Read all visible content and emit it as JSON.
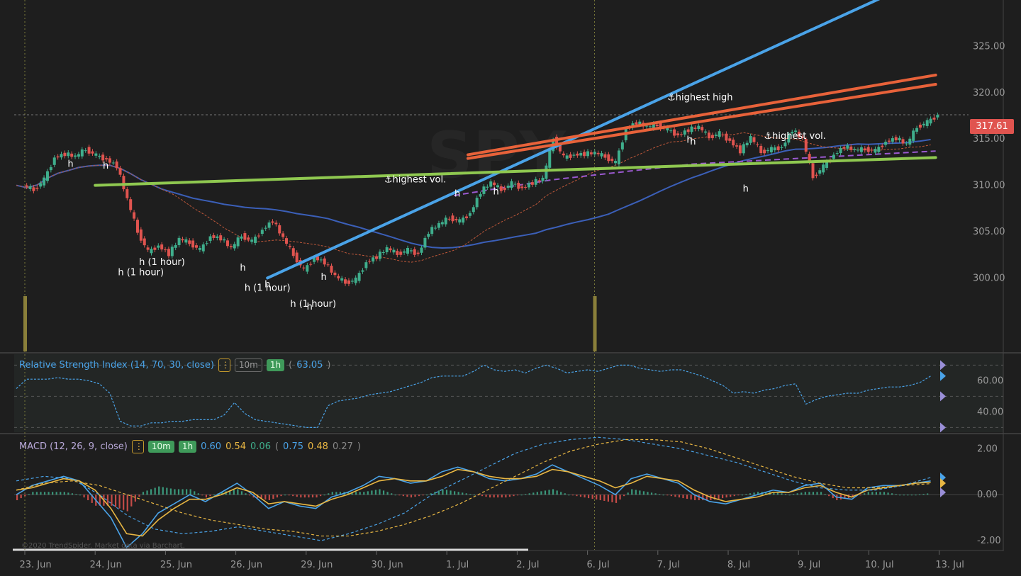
{
  "chart_data": [
    {
      "type": "candlestick",
      "watermark_ticker": "SPY",
      "last_price": "317.61",
      "y_ticks": [
        "325.00",
        "320.00",
        "315.00",
        "310.00",
        "305.00",
        "300.00"
      ],
      "ylim": [
        292,
        330
      ],
      "x_ticks": [
        "23. Jun",
        "24. Jun",
        "25. Jun",
        "26. Jun",
        "29. Jun",
        "30. Jun",
        "1. Jul",
        "2. Jul",
        "6. Jul",
        "7. Jul",
        "8. Jul",
        "9. Jul",
        "10. Jul",
        "13. Jul"
      ],
      "annotations": [
        {
          "text": "h",
          "x": 0.65,
          "y": 312.0
        },
        {
          "text": "h",
          "x": 1.15,
          "y": 311.8
        },
        {
          "text": "h (1 hour)",
          "x": 1.65,
          "y": 300.3
        },
        {
          "text": "h (1 hour)",
          "x": 1.95,
          "y": 301.4
        },
        {
          "text": "h",
          "x": 3.1,
          "y": 300.8
        },
        {
          "text": "h (1 hour)",
          "x": 3.45,
          "y": 298.6
        },
        {
          "text": "h",
          "x": 3.45,
          "y": 299.0
        },
        {
          "text": "h (1 hour)",
          "x": 4.1,
          "y": 296.9
        },
        {
          "text": "h",
          "x": 4.05,
          "y": 296.6
        },
        {
          "text": "h",
          "x": 4.25,
          "y": 299.8
        },
        {
          "text": "highest vol.",
          "x": 5.55,
          "y": 310.3
        },
        {
          "text": "h",
          "x": 6.15,
          "y": 308.8
        },
        {
          "text": "h",
          "x": 6.7,
          "y": 309.0
        },
        {
          "text": "highest high",
          "x": 9.6,
          "y": 319.2
        },
        {
          "text": "h",
          "x": 9.45,
          "y": 314.6
        },
        {
          "text": "h",
          "x": 9.5,
          "y": 314.4
        },
        {
          "text": "h",
          "x": 10.25,
          "y": 309.3
        },
        {
          "text": "highest vol.",
          "x": 10.95,
          "y": 315.0
        }
      ],
      "closes": [
        310.0,
        309.5,
        310.6,
        313.0,
        313.4,
        313.1,
        313.9,
        313.2,
        312.8,
        312.1,
        308.5,
        305.0,
        302.8,
        303.5,
        302.6,
        304.2,
        303.8,
        303.0,
        304.5,
        304.3,
        303.2,
        304.6,
        303.9,
        305.2,
        306.2,
        304.3,
        302.5,
        300.8,
        302.2,
        301.7,
        300.2,
        299.5,
        299.8,
        301.7,
        302.3,
        303.2,
        302.6,
        303.0,
        302.6,
        305.0,
        305.8,
        306.5,
        306.1,
        307.0,
        309.3,
        310.3,
        309.5,
        310.2,
        309.7,
        310.3,
        310.7,
        315.0,
        313.0,
        313.3,
        313.4,
        313.5,
        313.1,
        312.4,
        316.1,
        316.8,
        316.3,
        316.5,
        316.0,
        315.4,
        316.0,
        316.3,
        315.2,
        315.6,
        314.8,
        313.7,
        315.2,
        313.6,
        313.9,
        314.1,
        316.0,
        315.0,
        310.9,
        312.0,
        313.3,
        314.2,
        313.8,
        313.9,
        313.7,
        314.7,
        315.1,
        314.4,
        316.3,
        316.8,
        317.6
      ],
      "overlays": [
        {
          "name": "blue trendline",
          "color": "#4aa3e8",
          "points": [
            [
              3.45,
              300.0
            ],
            [
              12.4,
              331.0
            ]
          ]
        },
        {
          "name": "orange channel upper",
          "color": "#e8623a",
          "points": [
            [
              6.3,
              313.3
            ],
            [
              12.95,
              321.9
            ]
          ]
        },
        {
          "name": "orange channel lower",
          "color": "#e8623a",
          "points": [
            [
              6.3,
              312.9
            ],
            [
              12.95,
              320.9
            ]
          ]
        },
        {
          "name": "green support",
          "color": "#8fc850",
          "points": [
            [
              1.0,
              310.0
            ],
            [
              12.95,
              313.0
            ]
          ]
        }
      ],
      "bottom_time_range": [
        "23. Jun",
        "2. Jul"
      ],
      "copyright": "©2020 TrendSpider. Market data via Barchart."
    },
    {
      "type": "line",
      "label": "Relative Strength Index (14, 70, 30, close)",
      "timeframes": [
        "10m",
        "1h"
      ],
      "active_timeframe": "1h",
      "value": "63.05",
      "y_ticks": [
        "60.00",
        "40.00"
      ],
      "ylim": [
        27,
        77
      ],
      "bands": [
        70,
        50,
        30
      ],
      "values": [
        55,
        61,
        61,
        61,
        62,
        61,
        61,
        60,
        58,
        52,
        34,
        31,
        31,
        33,
        33,
        34,
        34,
        35,
        35,
        35,
        38,
        46,
        39,
        35,
        34,
        33,
        32,
        31,
        30,
        30,
        44,
        47,
        48,
        49,
        51,
        52,
        53,
        55,
        57,
        59,
        62,
        63,
        63,
        63,
        66,
        70,
        67,
        66,
        67,
        65,
        68,
        70,
        68,
        65,
        66,
        67,
        66,
        68,
        70,
        70,
        68,
        67,
        66,
        67,
        67,
        65,
        63,
        60,
        57,
        52,
        53,
        52,
        54,
        55,
        57,
        58,
        45,
        48,
        50,
        51,
        52,
        52,
        54,
        55,
        56,
        56,
        57,
        59,
        63
      ]
    },
    {
      "type": "line",
      "label": "MACD (12, 26, 9, close)",
      "timeframes": [
        "10m",
        "1h"
      ],
      "values_10m": [
        "0.60",
        "0.54",
        "0.06"
      ],
      "values_1h": [
        "0.75",
        "0.48",
        "0.27"
      ],
      "y_ticks": [
        "2.00",
        "0.00",
        "-2.00"
      ],
      "ylim": [
        -2.4,
        2.6
      ],
      "series": [
        {
          "name": "10m MACD",
          "color": "#4aa3e8",
          "values": [
            0.0,
            0.4,
            0.6,
            0.8,
            0.6,
            -0.2,
            -1.0,
            -2.3,
            -1.7,
            -0.8,
            -0.4,
            0.0,
            -0.3,
            0.1,
            0.5,
            0.0,
            -0.6,
            -0.3,
            -0.5,
            -0.6,
            -0.1,
            0.1,
            0.4,
            0.8,
            0.7,
            0.5,
            0.6,
            1.0,
            1.2,
            1.0,
            0.7,
            0.6,
            0.7,
            0.9,
            1.3,
            1.0,
            0.7,
            0.4,
            0.0,
            0.7,
            0.9,
            0.7,
            0.5,
            0.0,
            -0.3,
            -0.4,
            -0.2,
            0.0,
            0.2,
            0.1,
            0.4,
            0.5,
            -0.1,
            -0.2,
            0.3,
            0.4,
            0.4,
            0.5,
            0.6
          ]
        },
        {
          "name": "10m Signal",
          "color": "#e9b743",
          "values": [
            0.2,
            0.3,
            0.5,
            0.7,
            0.6,
            0.2,
            -0.6,
            -1.7,
            -1.8,
            -1.1,
            -0.6,
            -0.2,
            -0.2,
            0.0,
            0.3,
            0.1,
            -0.4,
            -0.3,
            -0.4,
            -0.5,
            -0.2,
            0.0,
            0.3,
            0.6,
            0.7,
            0.6,
            0.6,
            0.8,
            1.1,
            1.0,
            0.8,
            0.7,
            0.7,
            0.8,
            1.1,
            1.0,
            0.8,
            0.6,
            0.3,
            0.5,
            0.8,
            0.7,
            0.6,
            0.2,
            -0.1,
            -0.3,
            -0.2,
            -0.1,
            0.1,
            0.1,
            0.3,
            0.4,
            0.1,
            -0.1,
            0.2,
            0.3,
            0.4,
            0.5,
            0.54
          ]
        },
        {
          "name": "1h MACD",
          "color": "#4aa3e8",
          "values": [
            0.6,
            0.8,
            0.7,
            0.0,
            -0.9,
            -1.5,
            -1.7,
            -1.6,
            -1.4,
            -1.6,
            -1.8,
            -2.0,
            -1.7,
            -1.3,
            -0.8,
            0.0,
            0.6,
            1.2,
            1.8,
            2.2,
            2.4,
            2.5,
            2.4,
            2.2,
            2.0,
            1.7,
            1.4,
            1.0,
            0.6,
            0.3,
            0.2,
            0.2,
            0.4,
            0.75
          ]
        },
        {
          "name": "1h Signal",
          "color": "#e9b743",
          "values": [
            0.2,
            0.5,
            0.6,
            0.4,
            0.0,
            -0.4,
            -0.8,
            -1.1,
            -1.3,
            -1.5,
            -1.6,
            -1.8,
            -1.8,
            -1.6,
            -1.3,
            -0.9,
            -0.4,
            0.2,
            0.8,
            1.4,
            1.9,
            2.2,
            2.4,
            2.4,
            2.3,
            2.0,
            1.6,
            1.2,
            0.8,
            0.5,
            0.3,
            0.3,
            0.4,
            0.48
          ]
        }
      ]
    }
  ]
}
